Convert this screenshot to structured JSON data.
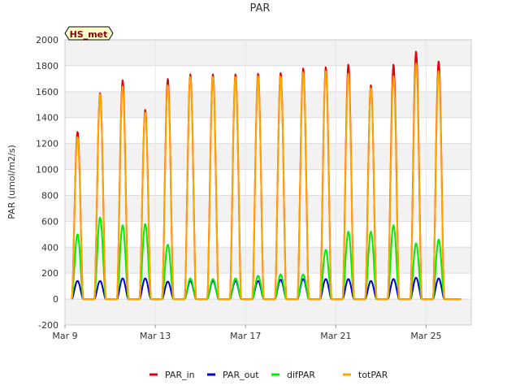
{
  "chart_data": {
    "type": "line",
    "title": "PAR",
    "ylabel": "PAR (umol/m2/s)",
    "xlabel": "",
    "badge": "HS_met",
    "ylim": [
      -200,
      2000
    ],
    "yticks": [
      -200,
      0,
      200,
      400,
      600,
      800,
      1000,
      1200,
      1400,
      1600,
      1800,
      2000
    ],
    "xlim": [
      "2025-03-09",
      "2025-03-27"
    ],
    "xticks": [
      {
        "label": "Mar 9",
        "date": "2025-03-09"
      },
      {
        "label": "Mar 13",
        "date": "2025-03-13"
      },
      {
        "label": "Mar 17",
        "date": "2025-03-17"
      },
      {
        "label": "Mar 21",
        "date": "2025-03-21"
      },
      {
        "label": "Mar 25",
        "date": "2025-03-25"
      }
    ],
    "grid": true,
    "legend_position": "bottom",
    "x": [
      "2025-03-09",
      "2025-03-10",
      "2025-03-11",
      "2025-03-12",
      "2025-03-13",
      "2025-03-14",
      "2025-03-15",
      "2025-03-16",
      "2025-03-17",
      "2025-03-18",
      "2025-03-19",
      "2025-03-20",
      "2025-03-21",
      "2025-03-22",
      "2025-03-23",
      "2025-03-24",
      "2025-03-25",
      "2025-03-26"
    ],
    "x_note": "daily peak values at local solar noon",
    "series": [
      {
        "name": "PAR_in",
        "color": "#e8000b",
        "values": [
          1290,
          1590,
          1690,
          1460,
          1700,
          1735,
          1735,
          1735,
          1740,
          1745,
          1780,
          1790,
          1810,
          1650,
          1810,
          1910,
          1835,
          0
        ]
      },
      {
        "name": "PAR_out",
        "color": "#0000cc",
        "values": [
          140,
          140,
          160,
          160,
          135,
          140,
          140,
          140,
          140,
          150,
          155,
          155,
          155,
          140,
          155,
          165,
          160,
          0
        ]
      },
      {
        "name": "difPAR",
        "color": "#00ee00",
        "values": [
          500,
          630,
          570,
          580,
          420,
          160,
          155,
          160,
          180,
          190,
          190,
          380,
          520,
          520,
          570,
          430,
          460,
          0
        ]
      },
      {
        "name": "totPAR",
        "color": "#ffa500",
        "values": [
          1250,
          1580,
          1640,
          1440,
          1650,
          1715,
          1715,
          1715,
          1720,
          1720,
          1750,
          1760,
          1740,
          1630,
          1720,
          1820,
          1760,
          0
        ]
      }
    ]
  }
}
